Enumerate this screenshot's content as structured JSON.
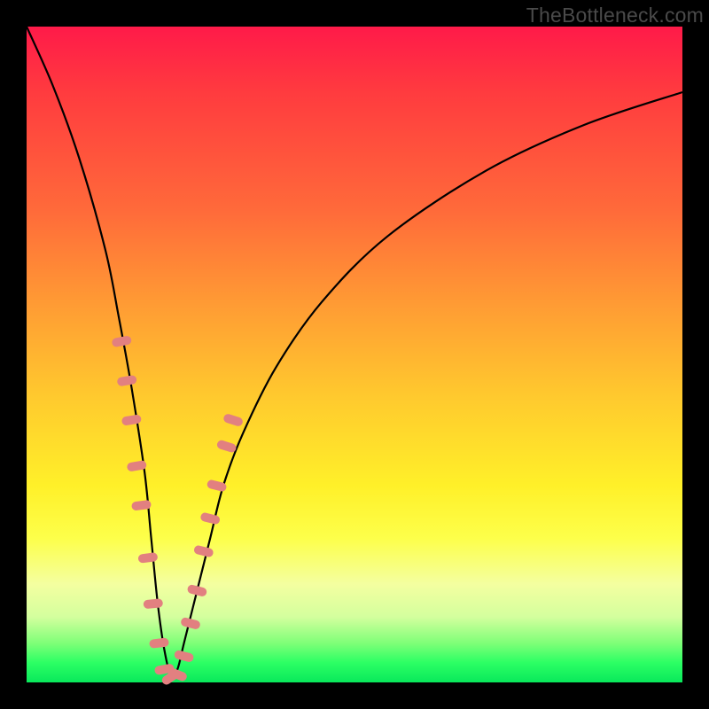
{
  "watermark": "TheBottleneck.com",
  "colors": {
    "background": "#000000",
    "gradient_top": "#ff1a49",
    "gradient_mid": "#ffe029",
    "gradient_bottom": "#09e85b",
    "curve": "#000000",
    "markers": "#e28080"
  },
  "chart_data": {
    "type": "line",
    "title": "",
    "xlabel": "",
    "ylabel": "",
    "xlim": [
      0,
      100
    ],
    "ylim": [
      0,
      100
    ],
    "grid": false,
    "legend": false,
    "description": "Bottleneck V-curve: sharp dip to ~0 near x≈22 then rising toward x=100; points near trough highlighted.",
    "series": [
      {
        "name": "bottleneck-curve",
        "x": [
          0,
          4,
          8,
          12,
          14,
          16,
          18,
          19,
          20,
          21,
          22,
          23,
          24,
          26,
          28,
          30,
          33,
          38,
          45,
          55,
          70,
          85,
          100
        ],
        "values": [
          100,
          91,
          80,
          66,
          56,
          45,
          32,
          22,
          12,
          5,
          1,
          2,
          6,
          14,
          22,
          30,
          38,
          48,
          58,
          68,
          78,
          85,
          90
        ]
      }
    ],
    "markers": [
      {
        "x": 14.5,
        "y": 52
      },
      {
        "x": 15.3,
        "y": 46
      },
      {
        "x": 16.0,
        "y": 40
      },
      {
        "x": 16.8,
        "y": 33
      },
      {
        "x": 17.5,
        "y": 27
      },
      {
        "x": 18.5,
        "y": 19
      },
      {
        "x": 19.3,
        "y": 12
      },
      {
        "x": 20.2,
        "y": 6
      },
      {
        "x": 21.0,
        "y": 2
      },
      {
        "x": 22.0,
        "y": 0.8
      },
      {
        "x": 23.0,
        "y": 1.2
      },
      {
        "x": 24.0,
        "y": 4
      },
      {
        "x": 25.0,
        "y": 9
      },
      {
        "x": 26.0,
        "y": 14
      },
      {
        "x": 27.0,
        "y": 20
      },
      {
        "x": 28.0,
        "y": 25
      },
      {
        "x": 29.0,
        "y": 30
      },
      {
        "x": 30.5,
        "y": 36
      },
      {
        "x": 31.5,
        "y": 40
      }
    ]
  }
}
